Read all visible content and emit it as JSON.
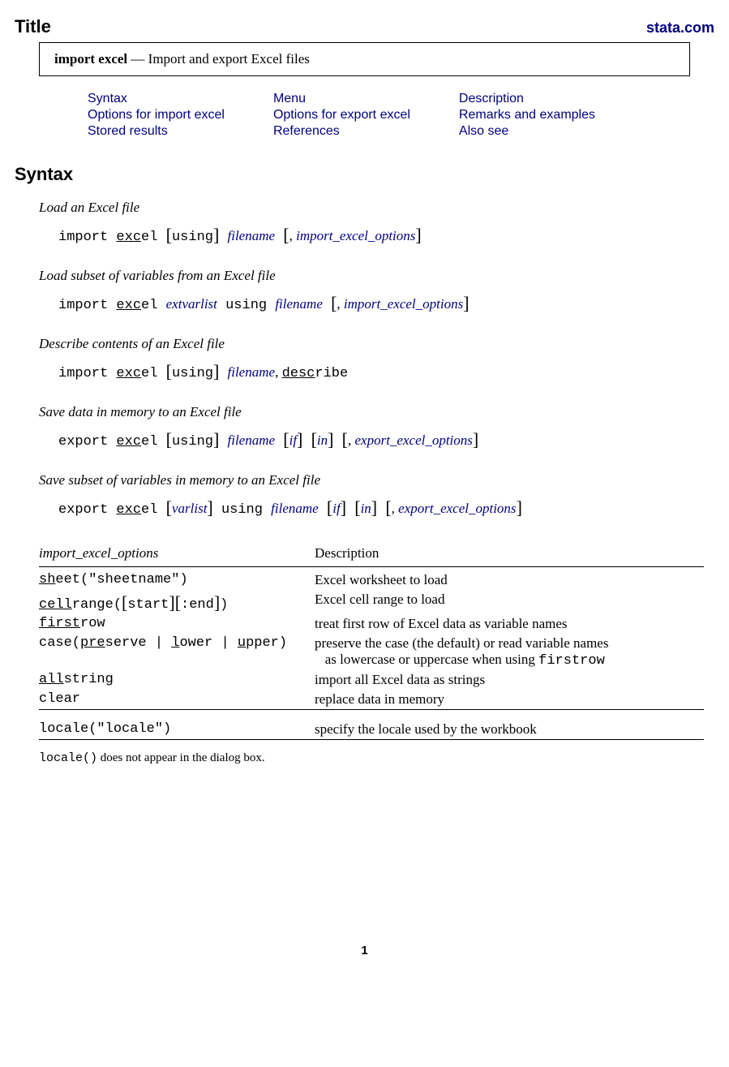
{
  "header": {
    "title": "Title",
    "site": "stata.com"
  },
  "title_box": {
    "command": "import excel",
    "sep": " — ",
    "desc": "Import and export Excel files"
  },
  "toc": {
    "r1c1": "Syntax",
    "r1c2": "Menu",
    "r1c3": "Description",
    "r2c1": "Options for import excel",
    "r2c2": "Options for export excel",
    "r2c3": "Remarks and examples",
    "r3c1": "Stored results",
    "r3c2": "References",
    "r3c3": "Also see"
  },
  "syntax_heading": "Syntax",
  "sections": {
    "s1": {
      "desc": "Load an Excel file"
    },
    "s2": {
      "desc": "Load subset of variables from an Excel file"
    },
    "s3": {
      "desc": "Describe contents of an Excel file"
    },
    "s4": {
      "desc": "Save data in memory to an Excel file"
    },
    "s5": {
      "desc": "Save subset of variables in memory to an Excel file"
    }
  },
  "cmds": {
    "import": "import ",
    "export": "export ",
    "exc_u": "exc",
    "el": "el ",
    "using": "using",
    "filename": "filename",
    "extvarlist": "extvarlist",
    "varlist": "varlist",
    "if": "if",
    "in": "in",
    "comma": ", ",
    "desc_u": "desc",
    "ribe": "ribe",
    "import_opts": "import_excel_options",
    "export_opts": "export_excel_options"
  },
  "table": {
    "h1": "import_excel_options",
    "h2": "Description",
    "rows": {
      "r1d": "Excel worksheet to load",
      "r2d": "Excel cell range to load",
      "r3d": "treat first row of Excel data as variable names",
      "r4d1": "preserve the case (the default) or read variable names",
      "r4d2": "as lowercase or uppercase when using ",
      "r4d2tt": "firstrow",
      "r5d": "import all Excel data as strings",
      "r6d": "replace data in memory",
      "r7d": "specify the locale used by the workbook"
    },
    "opts": {
      "sh": "sh",
      "eet": "eet(\"",
      "sheetname": "sheetname",
      "eet_close": "\")",
      "cellra": "cell",
      "range": "range(",
      "start": "start",
      "end": ":end",
      "range_close": ")",
      "first": "first",
      "row": "row",
      "case_open": "case(",
      "pre": "pre",
      "serve": "serve",
      "pipe1": "|",
      "l": "l",
      "ower": "ower",
      "pipe2": "|",
      "u": "u",
      "pper": "pper",
      "case_close": ")",
      "all": "all",
      "string": "string",
      "clear": "clear",
      "locale_open": "locale(\"",
      "locale": "locale",
      "locale_close": "\")"
    }
  },
  "footnote": {
    "tt": "locale()",
    "text": " does not appear in the dialog box."
  },
  "pagenum": "1"
}
